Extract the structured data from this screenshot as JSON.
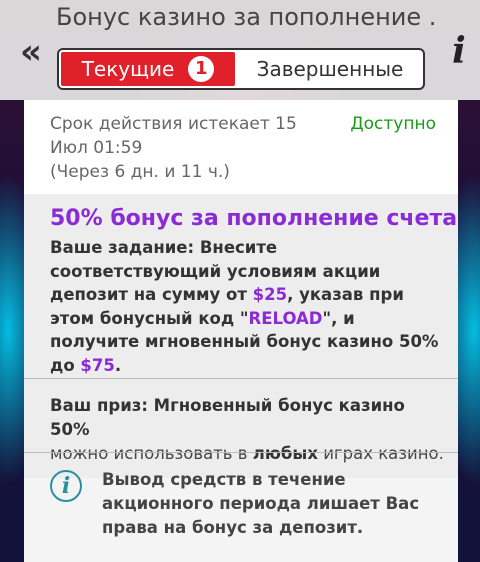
{
  "header": {
    "title": "Бонус казино за пополнение ...",
    "back_icon": "«",
    "info_icon": "i"
  },
  "tabs": {
    "current_label": "Текущие",
    "current_count": "1",
    "completed_label": "Завершенные"
  },
  "offer": {
    "expires": "Срок действия истекает 15 Июл 01:59",
    "remaining": "(Через 6 дн. и 11 ч.)",
    "status": "Доступно",
    "title": "50% бонус за пополнение счета",
    "task_part1": "Ваше задание: Внесите соответствующий условиям акции депозит на сумму от ",
    "task_amount": "$25",
    "task_part2": ", указав при этом бонусный код \"",
    "task_code": "RELOAD",
    "task_part3": "\", и получите мгновенный бонус казино 50% до ",
    "task_max": "$75",
    "task_part4": ".",
    "prize_label": "Ваш приз: Мгновенный бонус казино 50%",
    "prize_part1": "можно использовать в ",
    "prize_bold": "любых",
    "prize_part2": " играх казино.",
    "warning": "Вывод средств в течение акционного периода лишает Вас права на бонус за депозит."
  },
  "colors": {
    "accent_red": "#e0202a",
    "promo_purple": "#8a2bd6",
    "status_green": "#1a9a1a",
    "info_teal": "#2a8fa0"
  }
}
